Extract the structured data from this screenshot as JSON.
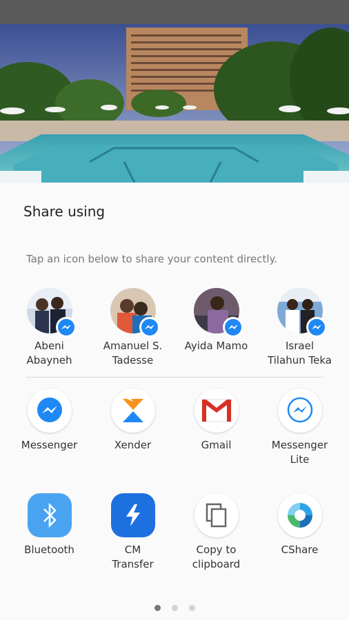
{
  "share_sheet": {
    "title": "Share using",
    "subtitle": "Tap an icon below to share your content directly."
  },
  "contacts": [
    {
      "name_line1": "Abeni",
      "name_line2": "Abayneh",
      "badge_icon": "messenger-badge-icon"
    },
    {
      "name_line1": "Amanuel S.",
      "name_line2": "Tadesse",
      "badge_icon": "messenger-badge-icon"
    },
    {
      "name_line1": "Ayida Mamo",
      "name_line2": "",
      "badge_icon": "messenger-badge-icon"
    },
    {
      "name_line1": "Israel",
      "name_line2": "Tilahun Teka",
      "badge_icon": "messenger-badge-icon"
    }
  ],
  "apps_row1": [
    {
      "line1": "Messenger",
      "line2": "",
      "icon": "messenger-icon"
    },
    {
      "line1": "Xender",
      "line2": "",
      "icon": "xender-icon"
    },
    {
      "line1": "Gmail",
      "line2": "",
      "icon": "gmail-icon"
    },
    {
      "line1": "Messenger",
      "line2": "Lite",
      "icon": "messenger-lite-icon"
    }
  ],
  "apps_row2": [
    {
      "line1": "Bluetooth",
      "line2": "",
      "icon": "bluetooth-icon"
    },
    {
      "line1": "CM",
      "line2": "Transfer",
      "icon": "cm-transfer-icon"
    },
    {
      "line1": "Copy to",
      "line2": "clipboard",
      "icon": "copy-icon"
    },
    {
      "line1": "CShare",
      "line2": "",
      "icon": "cshare-icon"
    }
  ],
  "pager": {
    "pages": 3,
    "current": 1
  },
  "colors": {
    "messenger_blue": "#1e88f5",
    "bluetooth_blue": "#4aa3f0",
    "cm_blue": "#1e6fe0",
    "gmail_red": "#d93025",
    "xender_orange": "#f7941d"
  }
}
